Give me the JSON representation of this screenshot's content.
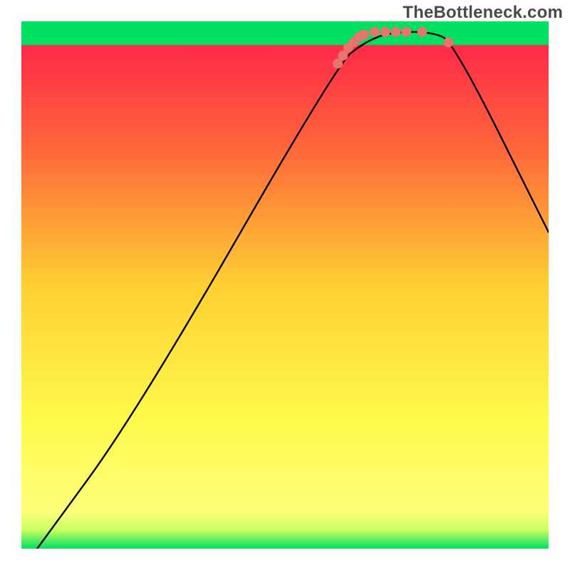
{
  "watermark": "TheBottleneck.com",
  "chart_data": {
    "type": "line",
    "title": "",
    "xlabel": "",
    "ylabel": "",
    "xlim": [
      0,
      100
    ],
    "ylim": [
      0,
      100
    ],
    "grid": false,
    "legend": false,
    "gradient_stops": [
      {
        "offset": 0.0,
        "color": "#ff1a4b"
      },
      {
        "offset": 0.25,
        "color": "#ff6a3a"
      },
      {
        "offset": 0.5,
        "color": "#ffcf33"
      },
      {
        "offset": 0.75,
        "color": "#fff94a"
      },
      {
        "offset": 0.93,
        "color": "#fdff7a"
      },
      {
        "offset": 0.965,
        "color": "#c8ff60"
      },
      {
        "offset": 1.0,
        "color": "#00e060"
      }
    ],
    "green_band_y": [
      95.5,
      100
    ],
    "series": [
      {
        "name": "bottleneck-curve",
        "color": "#000000",
        "points": [
          {
            "x": 3,
            "y": 0
          },
          {
            "x": 22,
            "y": 26
          },
          {
            "x": 60,
            "y": 92
          },
          {
            "x": 65,
            "y": 96
          },
          {
            "x": 70,
            "y": 98
          },
          {
            "x": 78,
            "y": 98
          },
          {
            "x": 82,
            "y": 96
          },
          {
            "x": 100,
            "y": 60
          }
        ]
      }
    ],
    "markers": {
      "name": "highlight-points",
      "color": "#e7746d",
      "points": [
        {
          "x": 60,
          "y": 92
        },
        {
          "x": 61,
          "y": 93.5
        },
        {
          "x": 62,
          "y": 95
        },
        {
          "x": 63,
          "y": 96
        },
        {
          "x": 64,
          "y": 97
        },
        {
          "x": 65,
          "y": 97.5
        },
        {
          "x": 67,
          "y": 98
        },
        {
          "x": 69,
          "y": 98
        },
        {
          "x": 71,
          "y": 98
        },
        {
          "x": 73,
          "y": 98
        },
        {
          "x": 76,
          "y": 98
        },
        {
          "x": 81,
          "y": 96
        }
      ]
    }
  }
}
